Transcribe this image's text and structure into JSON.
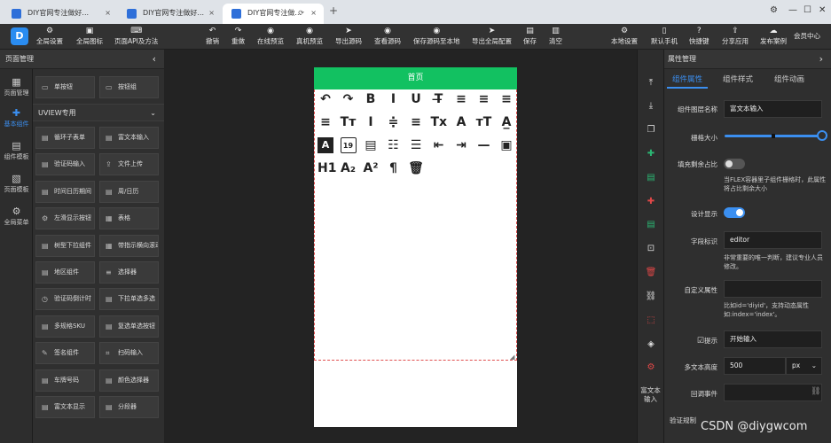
{
  "browser": {
    "tabs": [
      {
        "title": "DIY官网专注做好..."
      },
      {
        "title": "DIY官网专注做好..."
      },
      {
        "title": "DIY官网专注做..."
      }
    ],
    "new_tab": "+",
    "close": "×"
  },
  "toolbar": {
    "logo": "D",
    "left": [
      "全局设置",
      "全局图标",
      "页面API及方法"
    ],
    "center": [
      "撤销",
      "重做",
      "在线预览",
      "真机预览",
      "导出源码",
      "查看源码",
      "保存源码至本地",
      "导出全局配置",
      "保存",
      "清空"
    ],
    "right": [
      "本地设置",
      "默认手机",
      "快捷键",
      "分享应用",
      "发布案例",
      "会员中心"
    ]
  },
  "left_rail": {
    "title": "页面管理",
    "items": [
      "页面管理",
      "基本组件",
      "组件模板",
      "页面模板",
      "全局菜单"
    ]
  },
  "components": {
    "top": [
      "单按钮",
      "按钮组"
    ],
    "section_title": "UVIEW专用",
    "list": [
      "循环子表单",
      "富文本输入",
      "验证码输入",
      "文件上传",
      "时间日历期间",
      "周/日历",
      "左滑显示按钮",
      "表格",
      "树型下拉组件",
      "带指示横向滚动",
      "地区组件",
      "选择器",
      "验证码倒计时",
      "下拉单选多选",
      "多规格SKU",
      "复选单选按钮",
      "签名组件",
      "扫码输入",
      "车牌号码",
      "颜色选择器",
      "富文本显示",
      "分段器"
    ]
  },
  "canvas": {
    "page_title": "首页",
    "editor_icons": [
      "↶",
      "↷",
      "B",
      "I",
      "U",
      "T̶",
      "≡",
      "≡",
      "≡",
      "≡",
      "Tт",
      "I",
      "≑",
      "≡",
      "Tx",
      "A",
      "ᴛT",
      "A̲",
      "A",
      "19",
      "▤",
      "☷",
      "☰",
      "⇤",
      "⇥",
      "—",
      "▣",
      "H1",
      "A₂",
      "A²",
      "¶",
      "🗑"
    ]
  },
  "right_icons": {
    "label": "富文本输入"
  },
  "properties": {
    "title": "属性管理",
    "tabs": [
      "组件属性",
      "组件样式",
      "组件动画"
    ],
    "layer_name_label": "组件图层名称",
    "layer_name_value": "富文本输入",
    "grid_label": "栅格大小",
    "fill_label": "填充剩余占比",
    "fill_help": "当FLEX容器里子组件栅格时，此属性将占比剩余大小",
    "design_label": "设计显示",
    "field_label": "字段标识",
    "field_value": "editor",
    "field_help": "非常重要的唯一判断，建议专业人员修改。",
    "custom_label": "自定义属性",
    "custom_value": "",
    "custom_help": "比如id='diyid'，支持动态属性如:index='index'。",
    "tip_label": "提示",
    "tip_value": "开始输入",
    "height_label": "多文本高度",
    "height_value": "500",
    "height_unit": "px",
    "callback_label": "回调事件",
    "callback_value": "",
    "verify_label": "验证规制"
  },
  "watermark": "CSDN @diygwcom",
  "colors": {
    "accent": "#3b8ff0",
    "phone_header": "#12c161"
  }
}
